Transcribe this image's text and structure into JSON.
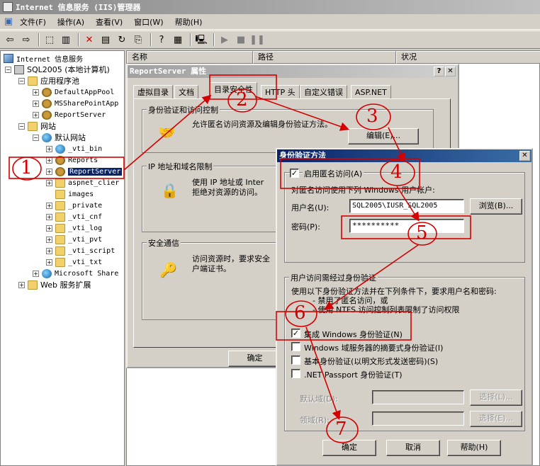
{
  "window": {
    "title": "Internet 信息服务 (IIS)管理器"
  },
  "menu": [
    "文件(F)",
    "操作(A)",
    "查看(V)",
    "窗口(W)",
    "帮助(H)"
  ],
  "tree": {
    "root": "Internet 信息服务",
    "computer": "SQL2005 (本地计算机)",
    "app_pools": "应用程序池",
    "pool_items": [
      "DefaultAppPool",
      "MSSharePointApp",
      "ReportServer"
    ],
    "websites": "网站",
    "default_site": "默认网站",
    "site_children": [
      "_vti_bin",
      "Reports",
      "ReportServer",
      "aspnet_clier",
      "images",
      "_private",
      "_vti_cnf",
      "_vti_log",
      "_vti_pvt",
      "_vti_script",
      "_vti_txt"
    ],
    "sharepoint": "Microsoft Share",
    "web_ext": "Web 服务扩展"
  },
  "list_columns": [
    "名称",
    "路径",
    "状况"
  ],
  "props_dialog": {
    "title": "ReportServer 属性",
    "tabs": [
      "虚拟目录",
      "文档",
      "目录安全性",
      "HTTP 头",
      "自定义错误",
      "ASP.NET"
    ],
    "auth_group": "身份验证和访问控制",
    "auth_desc": "允许匿名访问资源及编辑身份验证方法。",
    "edit_button": "编辑(E)...",
    "ip_group": "IP 地址和域名限制",
    "ip_desc": "使用 IP 地址或 Inter\n拒绝对资源的访问。",
    "secure_group": "安全通信",
    "secure_desc": "访问资源时，要求安全\n户端证书。",
    "ok": "确定"
  },
  "auth_dialog": {
    "title": "身份验证方法",
    "anon_check": "启用匿名访问(A)",
    "anon_desc": "对匿名访问使用下列 Windows 用户帐户:",
    "user_label": "用户名(U):",
    "user_value": "SQL2005\\IUSR_SQL2005",
    "browse": "浏览(B)...",
    "pwd_label": "密码(P):",
    "pwd_value": "**********",
    "auth_access_group": "用户访问需经过身份验证",
    "auth_desc_1": "使用以下身份验证方法并在下列条件下，要求用户名和密码:",
    "auth_desc_2": "- 禁用了匿名访问，或",
    "auth_desc_3": "- 使用 NTFS 访问控制列表限制了访问权限",
    "opt_integrated": "集成 Windows 身份验证(N)",
    "opt_digest": "Windows 域服务器的摘要式身份验证(I)",
    "opt_basic": "基本身份验证(以明文形式发送密码)(S)",
    "opt_passport": ".NET Passport 身份验证(T)",
    "default_domain": "默认域(D):",
    "realm": "领域(R):",
    "select1": "选择(L)...",
    "select2": "选择(E)...",
    "ok": "确定",
    "cancel": "取消",
    "help": "帮助(H)"
  },
  "annotations": [
    "1",
    "2",
    "3",
    "4",
    "5",
    "6",
    "7"
  ],
  "colors": {
    "annotation": "#d40000",
    "selection": "#0a246a"
  }
}
